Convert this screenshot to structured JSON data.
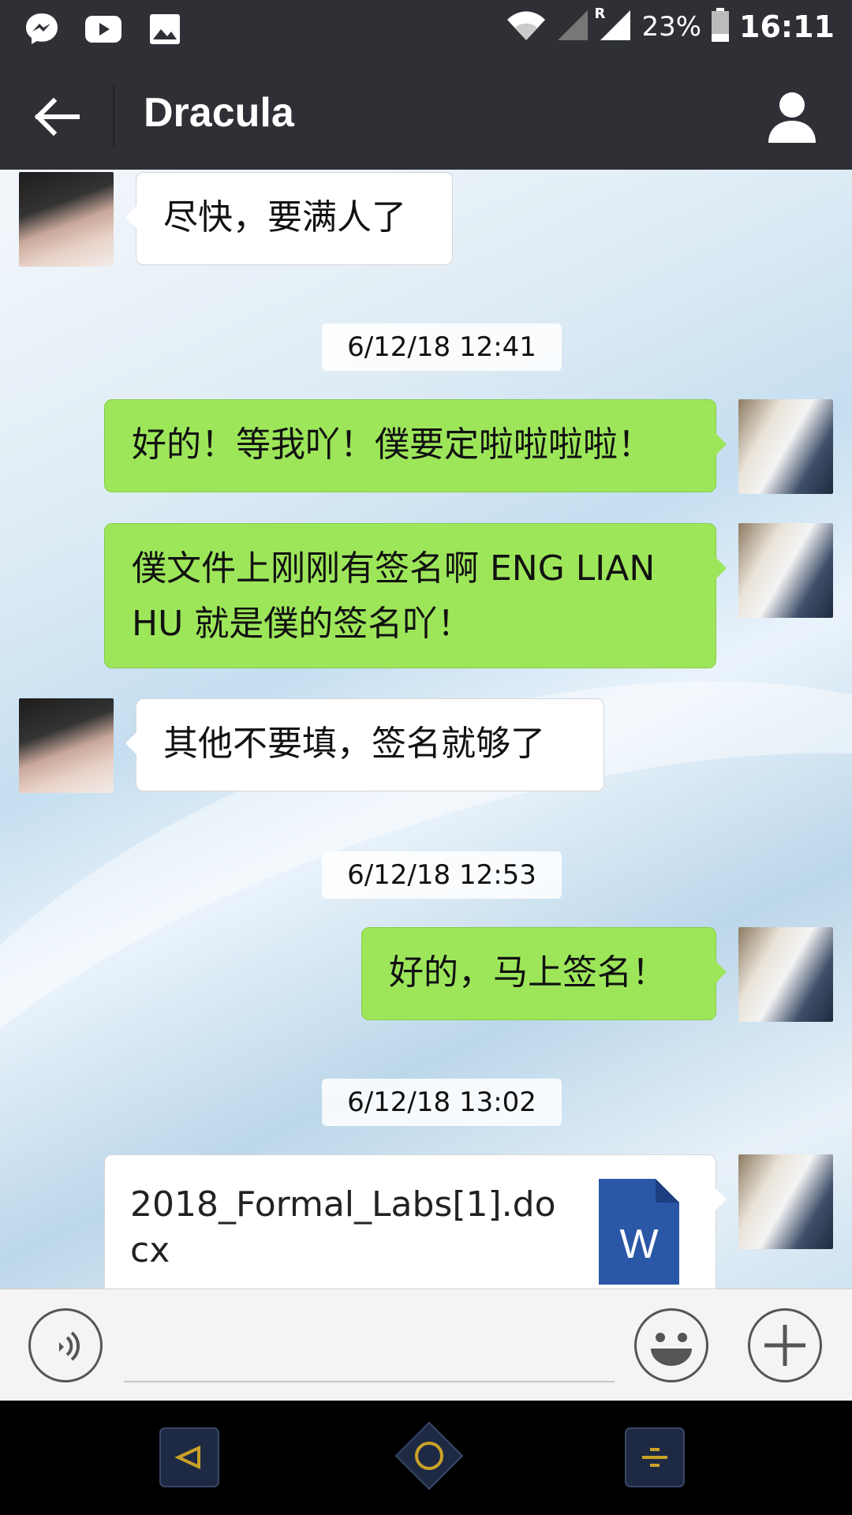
{
  "status_bar": {
    "battery_percent": "23%",
    "time": "16:11",
    "roaming_label": "R",
    "left_icons": [
      "messenger-icon",
      "youtube-icon",
      "gallery-icon"
    ],
    "right_icons": [
      "wifi-icon",
      "signal-icon",
      "signal-roaming-icon",
      "battery-icon"
    ]
  },
  "header": {
    "title": "Dracula",
    "back_icon": "arrow-left-icon",
    "profile_icon": "person-icon"
  },
  "chat": {
    "messages": [
      {
        "side": "in",
        "text": "尽快，要满人了"
      },
      {
        "type": "timestamp",
        "text": "6/12/18 12:41"
      },
      {
        "side": "out",
        "text": "好的！等我吖！僕要定啦啦啦啦！"
      },
      {
        "side": "out",
        "text_line1": "僕文件上刚刚有签名啊 ENG LIAN",
        "text_line2": "HU 就是僕的签名吖！"
      },
      {
        "side": "in",
        "text": "其他不要填，签名就够了"
      },
      {
        "type": "timestamp",
        "text": "6/12/18 12:53"
      },
      {
        "side": "out",
        "text": "好的，马上签名！"
      },
      {
        "type": "timestamp",
        "text": "6/12/18 13:02"
      },
      {
        "side": "out",
        "type": "file",
        "file_name": "2018_Formal_Labs[1].docx",
        "file_icon_letter": "W"
      }
    ]
  },
  "input_bar": {
    "voice_icon": "voice-icon",
    "emoji_icon": "smiley-icon",
    "add_icon": "plus-icon"
  },
  "nav_bar": {
    "icons": [
      "back-triangle-icon",
      "home-circle-icon",
      "menu-lines-icon"
    ],
    "accent_color": "#c9a227"
  },
  "colors": {
    "header_bg": "#2e3035",
    "outgoing_bubble": "#9de65a",
    "incoming_bubble": "#ffffff"
  }
}
